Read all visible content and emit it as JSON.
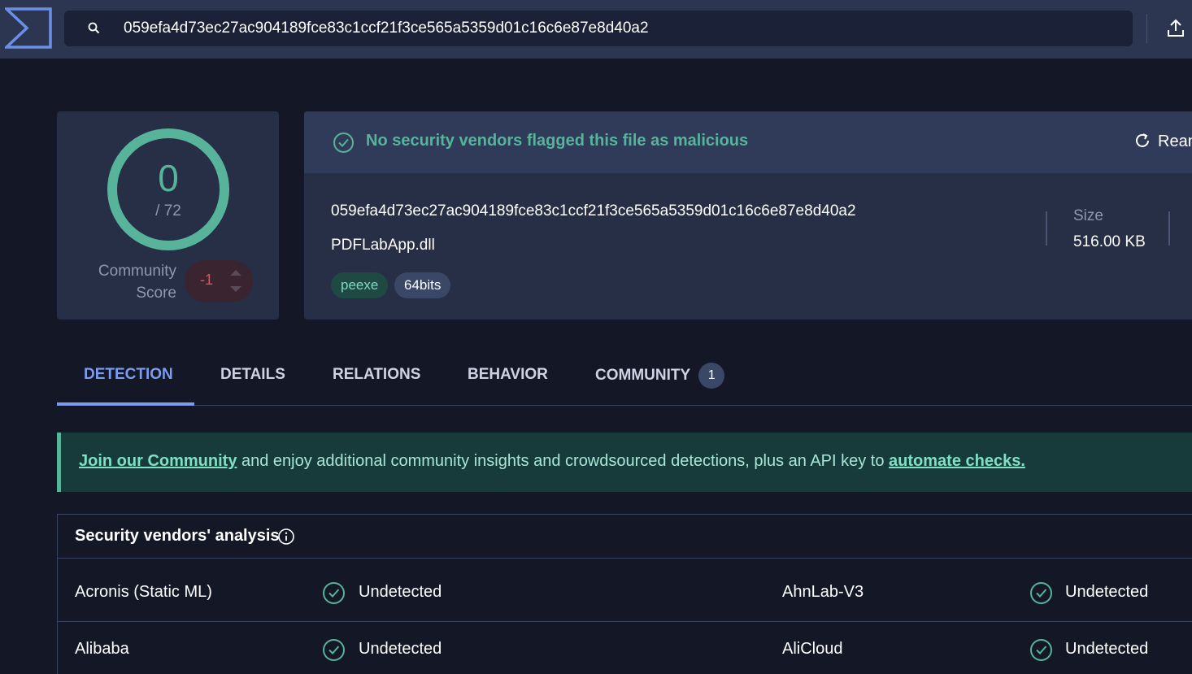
{
  "search": {
    "value": "059efa4d73ec27ac904189fce83c1ccf21f3ce565a5359d01c16c6e87e8d40a2"
  },
  "score": {
    "detections": "0",
    "total": "/ 72",
    "community_label": "Community Score",
    "community_value": "-1"
  },
  "summary": {
    "status_text": "No security vendors flagged this file as malicious",
    "reanalyze_label": "Rean",
    "hash": "059efa4d73ec27ac904189fce83c1ccf21f3ce565a5359d01c16c6e87e8d40a2",
    "file_name": "PDFLabApp.dll",
    "tags": [
      "peexe",
      "64bits"
    ],
    "size_label": "Size",
    "size_value": "516.00 KB"
  },
  "tabs": [
    {
      "label": "DETECTION",
      "active": true
    },
    {
      "label": "DETAILS"
    },
    {
      "label": "RELATIONS"
    },
    {
      "label": "BEHAVIOR"
    },
    {
      "label": "COMMUNITY",
      "badge": "1"
    }
  ],
  "banner": {
    "link1": "Join our Community",
    "middle": " and enjoy additional community insights and crowdsourced detections, plus an API key to ",
    "link2": "automate checks."
  },
  "vendors": {
    "title": "Security vendors' analysis",
    "rows": [
      {
        "left_name": "Acronis (Static ML)",
        "left_status": "Undetected",
        "right_name": "AhnLab-V3",
        "right_status": "Undetected"
      },
      {
        "left_name": "Alibaba",
        "left_status": "Undetected",
        "right_name": "AliCloud",
        "right_status": "Undetected"
      }
    ]
  },
  "colors": {
    "background": "#141726",
    "topbar": "#2c3651",
    "card": "#262f45",
    "accent": "#7c9cf0",
    "clean": "#57b39a",
    "negative": "#e8514f"
  }
}
